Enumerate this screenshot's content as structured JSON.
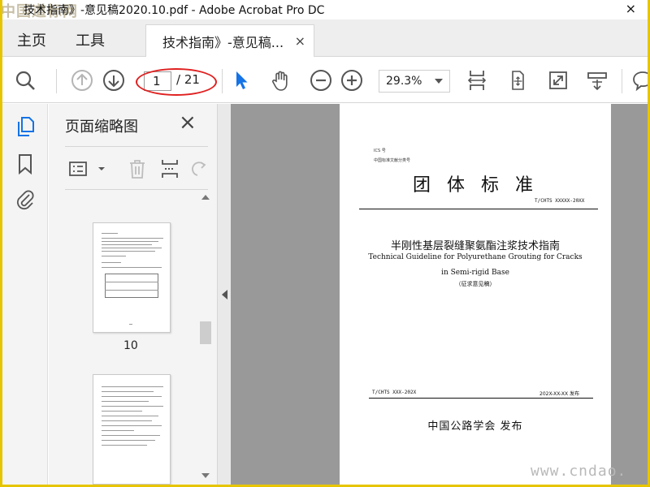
{
  "window": {
    "watermark_top": "中国道标网",
    "title": "技术指南》-意见稿2020.10.pdf - Adobe Acrobat Pro DC",
    "close_glyph": "×"
  },
  "menu": {
    "home": "主页",
    "tools": "工具",
    "tab_label": "技术指南》-意见稿...",
    "tab_close": "×"
  },
  "toolbar": {
    "current_page": "1",
    "total_pages": "/ 21",
    "zoom": "29.3%",
    "highlight_color": "#e02020",
    "accent_color": "#1473e6"
  },
  "sidebar": {
    "panel_title": "页面缩略图",
    "panel_close": "×",
    "thumb_label_10": "10"
  },
  "document": {
    "ics_label": "ICS 号",
    "class_label": "中国标准文献分类号",
    "big_title": "团体标准",
    "code": "T/CHTS XXXXX-20XX",
    "title_cn": "半刚性基层裂缝聚氨酯注浆技术指南",
    "title_en_1": "Technical Guideline for Polyurethane Grouting for Cracks",
    "title_en_2": "in Semi-rigid Base",
    "draft": "（征求意见稿）",
    "footer_left": "T/CHTS XXX-202X",
    "footer_right": "202X-XX-XX 发布",
    "publisher": "中国公路学会  发布"
  },
  "footer_watermark": "www.cndao."
}
